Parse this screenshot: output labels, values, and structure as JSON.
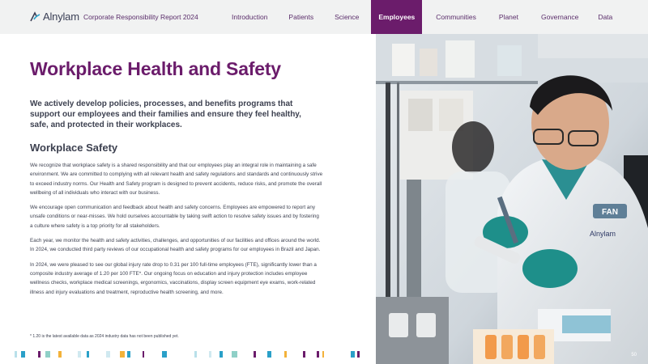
{
  "header": {
    "logo_text": "Alnylam",
    "report_title": "Corporate Responsibility Report 2024",
    "nav": [
      {
        "label": "Introduction",
        "active": false
      },
      {
        "label": "Patients",
        "active": false
      },
      {
        "label": "Science",
        "active": false
      },
      {
        "label": "Employees",
        "active": true
      },
      {
        "label": "Communities",
        "active": false
      },
      {
        "label": "Planet",
        "active": false
      },
      {
        "label": "Governance",
        "active": false
      },
      {
        "label": "Data",
        "active": false
      }
    ]
  },
  "main": {
    "title": "Workplace Health and Safety",
    "lead": "We actively develop policies, processes, and benefits programs that support our employees and their families and ensure they feel healthy, safe, and protected in their workplaces.",
    "section_title": "Workplace Safety",
    "paragraphs": [
      "We recognize that workplace safety is a shared responsibility and that our employees play an integral role in maintaining a safe environment. We are committed to complying with all relevant health and safety regulations and standards and continuously strive to exceed industry norms. Our Health and Safety program is designed to prevent accidents, reduce risks, and promote the overall wellbeing of all individuals who interact with our business.",
      "We encourage open communication and feedback about health and safety concerns. Employees are empowered to report any unsafe conditions or near-misses. We hold ourselves accountable by taking swift action to resolve safety issues and by fostering a culture where safety is a top priority for all stakeholders.",
      "Each year, we monitor the health and safety activities, challenges, and opportunities of our facilities and offices around the world. In 2024, we conducted third party reviews of our occupational health and safety programs for our employees in Brazil and Japan.",
      "In 2024, we were pleased to see our global injury rate drop to 0.31 per 100 full-time employees (FTE), significantly lower than a composite industry average of 1.20 per 100 FTE*. Our ongoing focus on education and injury protection includes employee wellness checks, workplace medical screenings, ergonomics, vaccinations, display screen equipment eye exams, work-related illness and injury evaluations and treatment, reproductive health screening, and more."
    ],
    "footnote": "* 1.20 is the latest available data as 2024 industry data has not been published yet."
  },
  "photo": {
    "badge_name": "FAN",
    "coat_logo": "Alnylam"
  },
  "page_number": "50",
  "colors": {
    "brand_purple": "#6b1c6b",
    "nav_bg": "#f1f2f2",
    "text_dark": "#3d4150"
  }
}
